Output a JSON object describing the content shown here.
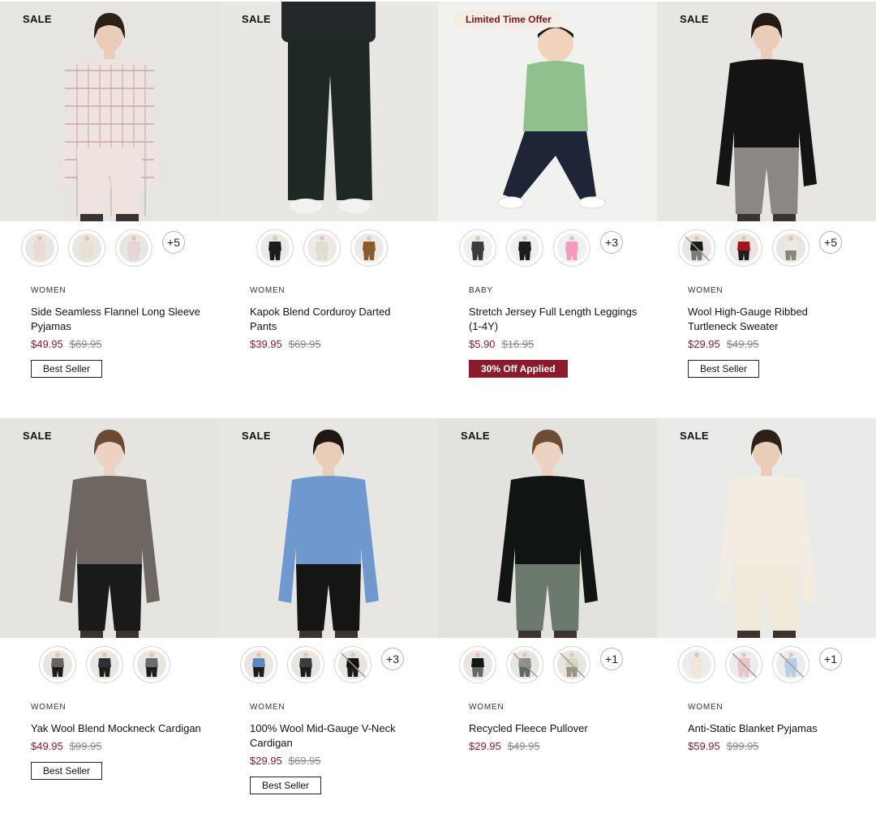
{
  "products": [
    {
      "tag": "SALE",
      "promo": "",
      "photo": {
        "bg": "#e7e5e2",
        "top": "#efe3e0",
        "bottom": "#efe3e0",
        "skin": "#e9cdb8",
        "hair": "#2b2119",
        "pattern": "plaid"
      },
      "swatches": [
        {
          "bg": "#e9e6e2",
          "top": "#eadad7",
          "bottom": "#eadad7",
          "crossed": false
        },
        {
          "bg": "#e9e6e2",
          "top": "#e7e1d2",
          "bottom": "#e7e1d2",
          "crossed": false
        },
        {
          "bg": "#e9e6e2",
          "top": "#e5d6d4",
          "bottom": "#e5d6d4",
          "crossed": false
        }
      ],
      "more": "+5",
      "category": "WOMEN",
      "name": "Side Seamless Flannel Long Sleeve Pyjamas",
      "price": "$49.95",
      "was": "$69.95",
      "badge": "Best Seller",
      "badge_style": "outline"
    },
    {
      "tag": "SALE",
      "promo": "",
      "photo": {
        "bg": "#e9e7e4",
        "top": "#1e2420",
        "bottom": "#1e2824",
        "skin": "#e9cdb8",
        "hair": "#2b2119",
        "pattern": "legs"
      },
      "swatches": [
        {
          "bg": "#eceae7",
          "top": "#1c1c1c",
          "bottom": "#1c1c1c",
          "crossed": false
        },
        {
          "bg": "#eceae7",
          "top": "#e2dccb",
          "bottom": "#e2dccb",
          "crossed": false
        },
        {
          "bg": "#eceae7",
          "top": "#8a5a2a",
          "bottom": "#8a5a2a",
          "crossed": false
        }
      ],
      "more": "",
      "category": "WOMEN",
      "name": "Kapok Blend Corduroy Darted Pants",
      "price": "$39.95",
      "was": "$69.95",
      "badge": "",
      "badge_style": "outline"
    },
    {
      "tag": "",
      "promo": "Limited Time Offer",
      "photo": {
        "bg": "#f1f1f0",
        "top": "#8fc08e",
        "bottom": "#1e2537",
        "skin": "#f1d2bc",
        "hair": "#1f1915",
        "pattern": "kid"
      },
      "swatches": [
        {
          "bg": "#f0f0f0",
          "top": "#3a3c40",
          "bottom": "#3a3c40",
          "crossed": false
        },
        {
          "bg": "#f0f0f0",
          "top": "#1d1d1f",
          "bottom": "#1d1d1f",
          "crossed": false
        },
        {
          "bg": "#f0f0f0",
          "top": "#f29ac0",
          "bottom": "#f29ac0",
          "crossed": false
        }
      ],
      "more": "+3",
      "category": "BABY",
      "name": "Stretch Jersey Full Length Leggings (1-4Y)",
      "price": "$5.90",
      "was": "$16.95",
      "badge": "30% Off Applied",
      "badge_style": "solid"
    },
    {
      "tag": "SALE",
      "promo": "",
      "photo": {
        "bg": "#e8e6e3",
        "top": "#141414",
        "bottom": "#8b8884",
        "skin": "#e9cdb8",
        "hair": "#241b14",
        "pattern": "plain"
      },
      "swatches": [
        {
          "bg": "#e9e6e2",
          "top": "#1a1a1a",
          "bottom": "#7c7a78",
          "crossed": true
        },
        {
          "bg": "#e9e6e2",
          "top": "#a3151f",
          "bottom": "#1e1e1e",
          "crossed": false
        },
        {
          "bg": "#e9e6e2",
          "top": "#efe9dd",
          "bottom": "#8a857c",
          "crossed": false
        }
      ],
      "more": "+5",
      "category": "WOMEN",
      "name": "Wool High-Gauge Ribbed Turtleneck Sweater",
      "price": "$29.95",
      "was": "$49.95",
      "badge": "Best Seller",
      "badge_style": "outline"
    },
    {
      "tag": "SALE",
      "promo": "",
      "photo": {
        "bg": "#e6e4e1",
        "top": "#6e6761",
        "bottom": "#1a1a1a",
        "skin": "#ecd3c1",
        "hair": "#6b4a33",
        "pattern": "plain"
      },
      "swatches": [
        {
          "bg": "#e9e6e2",
          "top": "#6a625c",
          "bottom": "#1c1c1c",
          "crossed": false
        },
        {
          "bg": "#e9e6e2",
          "top": "#2c2f33",
          "bottom": "#1c1c1c",
          "crossed": false
        },
        {
          "bg": "#e9e6e2",
          "top": "#6a6c6e",
          "bottom": "#1c1c1c",
          "crossed": false
        }
      ],
      "more": "",
      "category": "WOMEN",
      "name": "Yak Wool Blend Mockneck Cardigan",
      "price": "$49.95",
      "was": "$99.95",
      "badge": "Best Seller",
      "badge_style": "outline"
    },
    {
      "tag": "SALE",
      "promo": "",
      "photo": {
        "bg": "#e8e6e3",
        "top": "#6f98cf",
        "bottom": "#151515",
        "skin": "#e9cdb8",
        "hair": "#1e1712",
        "pattern": "plain"
      },
      "swatches": [
        {
          "bg": "#e9e6e2",
          "top": "#5b87c2",
          "bottom": "#1c1c1c",
          "crossed": false
        },
        {
          "bg": "#e9e6e2",
          "top": "#3a3d41",
          "bottom": "#1c1c1c",
          "crossed": false
        },
        {
          "bg": "#e9e6e2",
          "top": "#141414",
          "bottom": "#1c1c1c",
          "crossed": true
        }
      ],
      "more": "+3",
      "category": "WOMEN",
      "name": "100% Wool Mid-Gauge V-Neck Cardigan",
      "price": "$29.95",
      "was": "$69.95",
      "badge": "Best Seller",
      "badge_style": "outline"
    },
    {
      "tag": "SALE",
      "promo": "",
      "photo": {
        "bg": "#e4e2df",
        "top": "#101513",
        "bottom": "#6b7a6d",
        "skin": "#ecd3c1",
        "hair": "#6e4d35",
        "pattern": "plain"
      },
      "swatches": [
        {
          "bg": "#e9e6e2",
          "top": "#14171a",
          "bottom": "#5f6a62",
          "crossed": false
        },
        {
          "bg": "#e9e6e2",
          "top": "#8b8d90",
          "bottom": "#5f6a62",
          "crossed": true
        },
        {
          "bg": "#e9e6e2",
          "top": "#d9d3c2",
          "bottom": "#9a9488",
          "crossed": true
        }
      ],
      "more": "+1",
      "category": "WOMEN",
      "name": "Recycled Fleece Pullover",
      "price": "$29.95",
      "was": "$49.95",
      "badge": "",
      "badge_style": "outline"
    },
    {
      "tag": "SALE",
      "promo": "",
      "photo": {
        "bg": "#eaeae9",
        "top": "#f2ede0",
        "bottom": "#f0eadb",
        "skin": "#e9cdb8",
        "hair": "#2b2119",
        "pattern": "plain"
      },
      "swatches": [
        {
          "bg": "#ececec",
          "top": "#efe8d8",
          "bottom": "#efe8d8",
          "crossed": false
        },
        {
          "bg": "#ececec",
          "top": "#e7c6c8",
          "bottom": "#e7c6c8",
          "crossed": true
        },
        {
          "bg": "#ececec",
          "top": "#b9cde2",
          "bottom": "#b9cde2",
          "crossed": true
        }
      ],
      "more": "+1",
      "category": "WOMEN",
      "name": "Anti-Static Blanket Pyjamas",
      "price": "$59.95",
      "was": "$99.95",
      "badge": "",
      "badge_style": "outline"
    }
  ]
}
